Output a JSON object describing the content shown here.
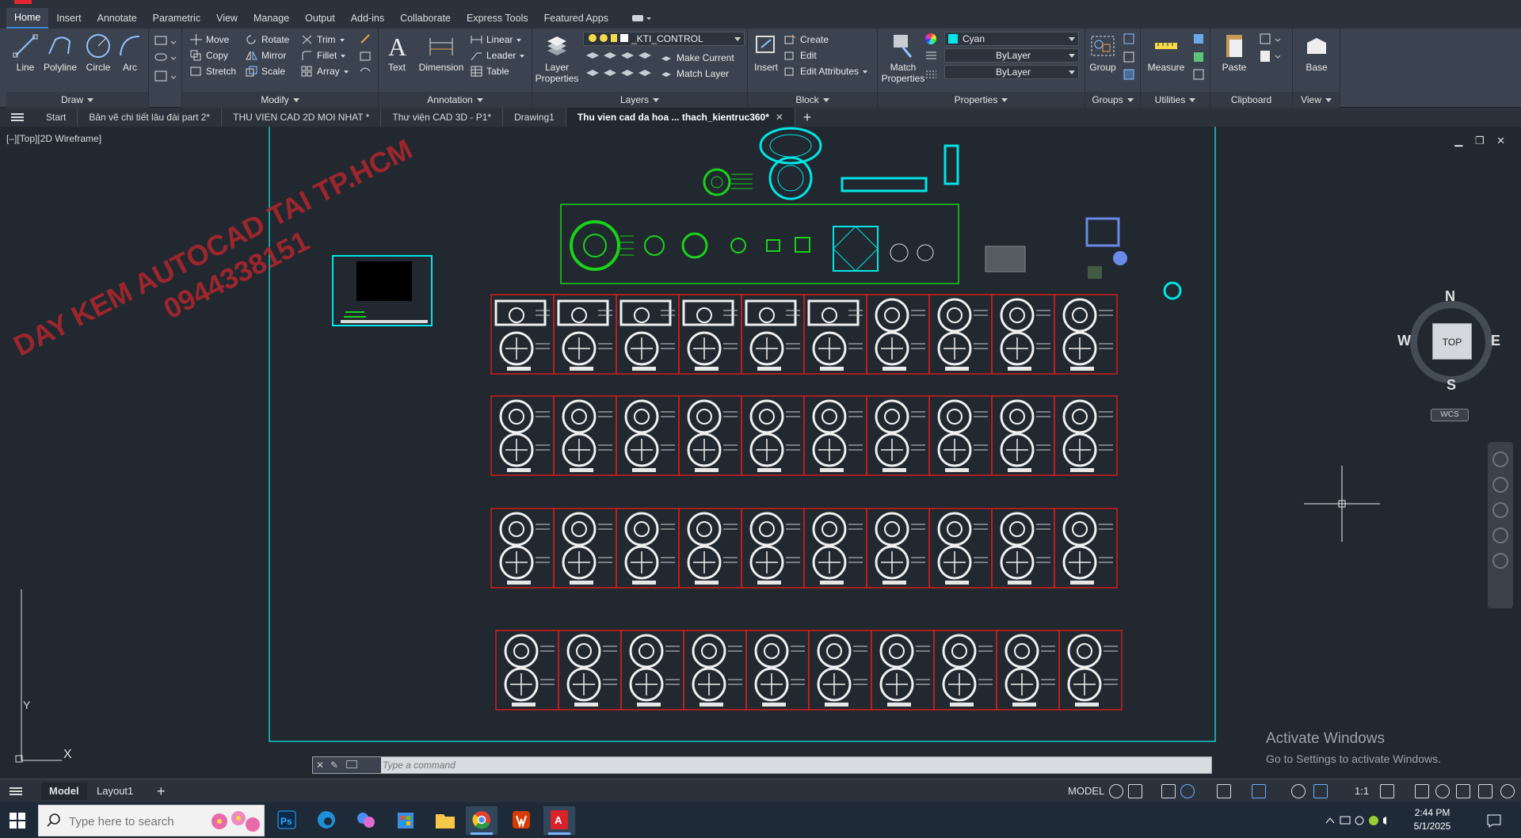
{
  "ribbon_tabs": [
    "Home",
    "Insert",
    "Annotate",
    "Parametric",
    "View",
    "Manage",
    "Output",
    "Add-ins",
    "Collaborate",
    "Express Tools",
    "Featured Apps"
  ],
  "active_ribbon_tab": "Home",
  "draw": {
    "line": "Line",
    "polyline": "Polyline",
    "circle": "Circle",
    "arc": "Arc",
    "title": "Draw"
  },
  "modify": {
    "move": "Move",
    "rotate": "Rotate",
    "trim": "Trim",
    "copy": "Copy",
    "mirror": "Mirror",
    "fillet": "Fillet",
    "stretch": "Stretch",
    "scale": "Scale",
    "array": "Array",
    "title": "Modify"
  },
  "annotation": {
    "text": "Text",
    "dimension": "Dimension",
    "linear": "Linear",
    "leader": "Leader",
    "table": "Table",
    "title": "Annotation"
  },
  "layers": {
    "layer_properties_1": "Layer",
    "layer_properties_2": "Properties",
    "current_layer": "_KTI_CONTROL",
    "make_current": "Make Current",
    "match_layer": "Match Layer",
    "title": "Layers"
  },
  "block": {
    "insert": "Insert",
    "create": "Create",
    "edit": "Edit",
    "edit_attributes": "Edit Attributes",
    "title": "Block"
  },
  "properties": {
    "match_1": "Match",
    "match_2": "Properties",
    "color": "Cyan",
    "linetype": "ByLayer",
    "lineweight": "ByLayer",
    "title": "Properties"
  },
  "groups": {
    "group": "Group",
    "title": "Groups"
  },
  "utilities": {
    "measure": "Measure",
    "title": "Utilities"
  },
  "clipboard": {
    "paste": "Paste",
    "title": "Clipboard"
  },
  "view_panel": {
    "base": "Base",
    "title": "View"
  },
  "file_tabs": [
    {
      "label": "Start"
    },
    {
      "label": "Bản vẽ chi tiết lâu đài part 2*"
    },
    {
      "label": "THU VIEN CAD 2D MOI NHAT *"
    },
    {
      "label": "Thư viện CAD 3D - P1*"
    },
    {
      "label": "Drawing1"
    },
    {
      "label": "Thu vien cad da hoa ... thach_kientruc360*"
    }
  ],
  "viewport_label": "[–][Top][2D Wireframe]",
  "watermark": {
    "line1": "DAY KEM AUTOCAD TAI TP.HCM",
    "line2": "0944338151"
  },
  "viewcube": {
    "face": "TOP",
    "north": "N",
    "south": "S",
    "east": "E",
    "west": "W",
    "wcs": "WCS"
  },
  "ucs": {
    "x": "X",
    "y": "Y"
  },
  "activate_windows": {
    "title": "Activate Windows",
    "subtitle": "Go to Settings to activate Windows."
  },
  "command_line": {
    "placeholder": "Type a command"
  },
  "layout_tabs": [
    "Model",
    "Layout1"
  ],
  "status": {
    "space": "MODEL",
    "scale": "1:1"
  },
  "taskbar": {
    "search_placeholder": "Type here to search",
    "time": "2:44 PM",
    "date": "5/1/2025"
  },
  "colors": {
    "cyan": "#00e5e5",
    "green": "#19d219",
    "red": "#d21e1e",
    "accent": "#3b82d6"
  }
}
